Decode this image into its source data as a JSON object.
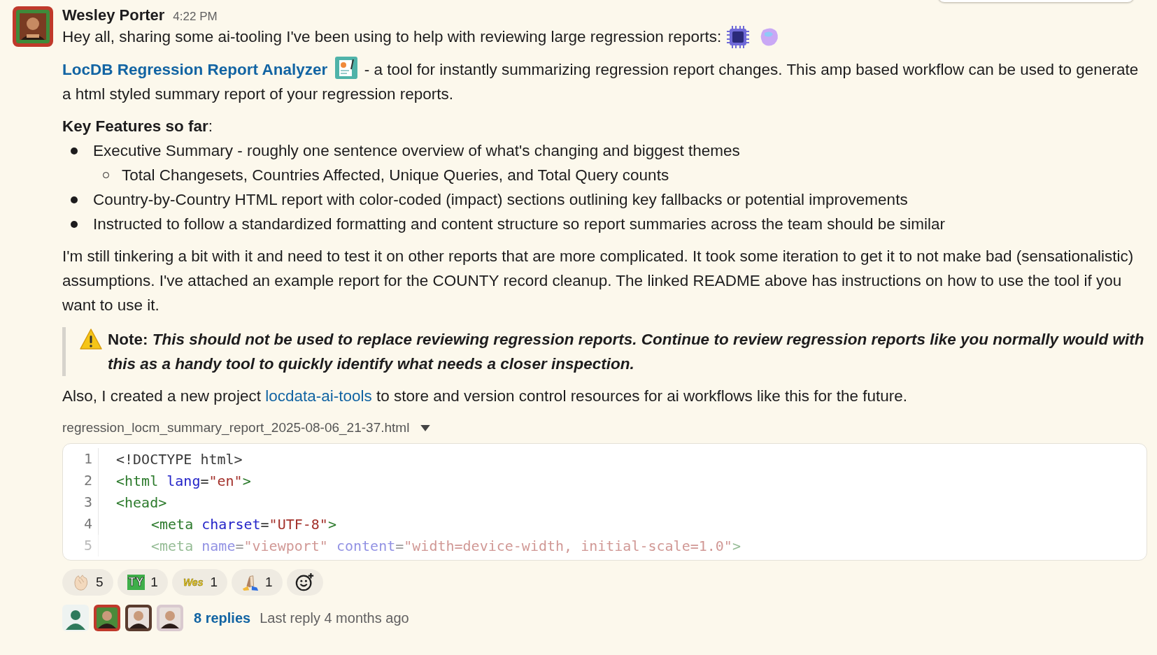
{
  "message": {
    "author": "Wesley Porter",
    "time": "4:22 PM",
    "intro": "Hey all, sharing some ai-tooling I've been using to help with reviewing large regression reports:",
    "tool_link": "LocDB Regression Report Analyzer",
    "tool_text": " - a tool for instantly summarizing regression report changes. This amp based workflow can be used to generate a html styled summary report of your regression reports.",
    "features_heading": "**Key Features so far**:",
    "features": [
      {
        "text": "Executive Summary - roughly one sentence overview of what's changing and biggest themes",
        "children": [
          {
            "text": "Total Changesets, Countries Affected, Unique Queries, and Total Query counts"
          }
        ]
      },
      {
        "text": "Country-by-Country HTML report with color-coded (impact) sections outlining key fallbacks or potential improvements"
      },
      {
        "text": "Instructed to follow a standardized formatting and content structure so report summaries across the team should be similar"
      }
    ],
    "paragraph": "I'm still tinkering a bit with it and need to test it on other reports that are more complicated. It took some iteration to get it to not make bad (sensationalistic) assumptions. I've attached an example report for the COUNTY record cleanup. The linked README above has instructions on how to use the tool if you want to use it.",
    "note": "Note: *This should not be used to replace reviewing regression reports. Continue to review regression reports like you normally would with this as a handy tool to quickly identify what needs a closer inspection.*",
    "also_before": "Also, I created a new project ",
    "also_link": "locdata-ai-tools",
    "also_after": " to store and version control resources for ai workflows like this for the future."
  },
  "attachment": {
    "filename": "regression_locm_summary_report_2025-08-06_21-37.html",
    "lines": [
      {
        "number": "1",
        "indent": false,
        "faded": false,
        "tokens": [
          {
            "kind": "plain",
            "text": "<!DOCTYPE html>"
          }
        ]
      },
      {
        "number": "2",
        "indent": false,
        "faded": false,
        "tokens": [
          {
            "kind": "tag",
            "text": "<html"
          },
          {
            "kind": "attr",
            "text": " lang"
          },
          {
            "kind": "plain",
            "text": "="
          },
          {
            "kind": "str",
            "text": "\"en\""
          },
          {
            "kind": "tag",
            "text": ">"
          }
        ]
      },
      {
        "number": "3",
        "indent": false,
        "faded": false,
        "tokens": [
          {
            "kind": "tag",
            "text": "<head>"
          }
        ]
      },
      {
        "number": "4",
        "indent": true,
        "faded": false,
        "tokens": [
          {
            "kind": "tag",
            "text": "<meta"
          },
          {
            "kind": "attr",
            "text": " charset"
          },
          {
            "kind": "plain",
            "text": "="
          },
          {
            "kind": "str",
            "text": "\"UTF-8\""
          },
          {
            "kind": "tag",
            "text": ">"
          }
        ]
      },
      {
        "number": "5",
        "indent": true,
        "faded": true,
        "tokens": [
          {
            "kind": "tag",
            "text": "<meta"
          },
          {
            "kind": "attr",
            "text": " name"
          },
          {
            "kind": "plain",
            "text": "="
          },
          {
            "kind": "str",
            "text": "\"viewport\""
          },
          {
            "kind": "attr",
            "text": " content"
          },
          {
            "kind": "plain",
            "text": "="
          },
          {
            "kind": "str",
            "text": "\"width=device-width, initial-scale=1.0\""
          },
          {
            "kind": "tag",
            "text": ">"
          }
        ]
      }
    ]
  },
  "reactions": [
    {
      "kind": "clap",
      "count": "5"
    },
    {
      "kind": "ty",
      "emoji_text": "TY",
      "count": "1"
    },
    {
      "kind": "wes",
      "emoji_text": "Wes",
      "count": "1"
    },
    {
      "kind": "highfive",
      "count": "1"
    }
  ],
  "thread": {
    "avatars": [
      {
        "kind": "silhouette"
      },
      {
        "kind": "picture"
      },
      {
        "kind": "picture"
      },
      {
        "kind": "picture"
      }
    ],
    "replies": "8 replies",
    "last_reply": "Last reply 4 months ago"
  }
}
